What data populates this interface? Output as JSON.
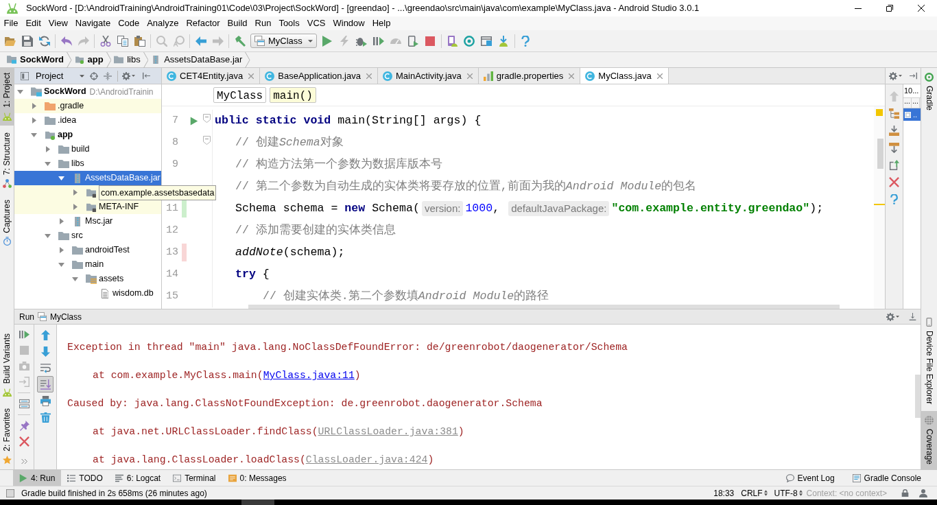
{
  "window": {
    "title": "SockWord - [D:\\AndroidTraining\\AndroidTraining01\\Code\\03\\Project\\SockWord] - [greendao] - ...\\greendao\\src\\main\\java\\com\\example\\MyClass.java - Android Studio 3.0.1"
  },
  "menu": [
    "File",
    "Edit",
    "View",
    "Navigate",
    "Code",
    "Analyze",
    "Refactor",
    "Build",
    "Run",
    "Tools",
    "VCS",
    "Window",
    "Help"
  ],
  "toolbar": [
    [
      {
        "kind": "open",
        "disabled": false
      },
      {
        "kind": "save",
        "disabled": false
      },
      {
        "kind": "sync",
        "disabled": false
      }
    ],
    [
      {
        "kind": "undo",
        "disabled": false
      },
      {
        "kind": "redo",
        "disabled": true
      }
    ],
    [
      {
        "kind": "cut",
        "disabled": false
      },
      {
        "kind": "copy",
        "disabled": false
      },
      {
        "kind": "paste",
        "disabled": false
      }
    ],
    [
      {
        "kind": "find",
        "disabled": true
      },
      {
        "kind": "replace",
        "disabled": true
      }
    ],
    [
      {
        "kind": "back",
        "disabled": false
      },
      {
        "kind": "forward",
        "disabled": true
      }
    ],
    [
      {
        "kind": "make",
        "disabled": false
      },
      {
        "kind": "run_config",
        "label": "MyClass"
      },
      {
        "kind": "run",
        "disabled": false
      },
      {
        "kind": "apply_changes",
        "disabled": true
      },
      {
        "kind": "debug",
        "disabled": false
      },
      {
        "kind": "profile",
        "disabled": false
      },
      {
        "kind": "attach",
        "disabled": true
      },
      {
        "kind": "attach_debugger",
        "disabled": false
      },
      {
        "kind": "stop",
        "disabled": false
      }
    ],
    [
      {
        "kind": "avd",
        "disabled": false
      },
      {
        "kind": "sync_gradle",
        "disabled": false
      },
      {
        "kind": "structure",
        "disabled": false
      },
      {
        "kind": "sdk",
        "disabled": false
      }
    ],
    [
      {
        "kind": "help",
        "disabled": false
      }
    ]
  ],
  "navigation_bar": [
    {
      "label": "SockWord",
      "kind": "project"
    },
    {
      "label": "app",
      "kind": "module"
    },
    {
      "label": "libs",
      "kind": "folder"
    },
    {
      "label": "AssetsDataBase.jar",
      "kind": "jar"
    }
  ],
  "left_tool_strip": {
    "top": [
      {
        "label": "1: Project",
        "kind": "android",
        "selected": true
      },
      {
        "label": "7: Structure",
        "kind": "structure",
        "selected": false
      },
      {
        "label": "Captures",
        "kind": "captures",
        "selected": false
      }
    ],
    "bottom": [
      {
        "label": "Build Variants",
        "kind": "android",
        "selected": false
      },
      {
        "label": "2: Favorites",
        "kind": "star",
        "selected": false
      }
    ]
  },
  "project_panel": {
    "title": "Project",
    "tree": [
      {
        "label": "SockWord",
        "kind": "project",
        "location": "D:\\AndroidTrainin",
        "expanded": true,
        "selected": false,
        "highlighted": false,
        "hovered": false,
        "children": [
          {
            "label": ".gradle",
            "kind": "excluded_folder",
            "expanded": false,
            "selected": false,
            "highlighted": true,
            "hovered": false
          },
          {
            "label": ".idea",
            "kind": "folder",
            "expanded": false,
            "selected": false,
            "highlighted": false,
            "hovered": false
          },
          {
            "label": "app",
            "kind": "module",
            "expanded": true,
            "selected": false,
            "highlighted": false,
            "hovered": false,
            "children": [
              {
                "label": "build",
                "kind": "folder",
                "expanded": false,
                "selected": false,
                "highlighted": false,
                "hovered": false
              },
              {
                "label": "libs",
                "kind": "folder",
                "expanded": true,
                "selected": false,
                "highlighted": false,
                "hovered": false,
                "children": [
                  {
                    "label": "AssetsDataBase.jar",
                    "kind": "jar",
                    "expanded": true,
                    "selected": true,
                    "highlighted": false,
                    "hovered": false,
                    "children": [
                      {
                        "label": "com.example.assetsbasedata",
                        "kind": "jar_package",
                        "expanded": false,
                        "selected": false,
                        "highlighted": true,
                        "hovered": true
                      },
                      {
                        "label": "META-INF",
                        "kind": "jar_package",
                        "expanded": false,
                        "selected": false,
                        "highlighted": true,
                        "hovered": false
                      }
                    ]
                  },
                  {
                    "label": "Msc.jar",
                    "kind": "jar",
                    "expanded": false,
                    "selected": false,
                    "highlighted": false,
                    "hovered": false
                  }
                ]
              },
              {
                "label": "src",
                "kind": "folder",
                "expanded": true,
                "selected": false,
                "highlighted": false,
                "hovered": false,
                "children": [
                  {
                    "label": "androidTest",
                    "kind": "folder",
                    "expanded": false,
                    "selected": false,
                    "highlighted": false,
                    "hovered": false
                  },
                  {
                    "label": "main",
                    "kind": "folder",
                    "expanded": true,
                    "selected": false,
                    "highlighted": false,
                    "hovered": false,
                    "children": [
                      {
                        "label": "assets",
                        "kind": "assets_folder",
                        "expanded": true,
                        "selected": false,
                        "highlighted": false,
                        "hovered": false,
                        "children": [
                          {
                            "label": "wisdom.db",
                            "kind": "file",
                            "selected": false,
                            "highlighted": false,
                            "hovered": false
                          }
                        ]
                      }
                    ]
                  }
                ]
              }
            ]
          }
        ]
      }
    ]
  },
  "editor": {
    "tabs": [
      {
        "label": "CET4Entity.java",
        "kind": "java",
        "selected": false
      },
      {
        "label": "BaseApplication.java",
        "kind": "java",
        "selected": false
      },
      {
        "label": "MainActivity.java",
        "kind": "java",
        "selected": false
      },
      {
        "label": "gradle.properties",
        "kind": "properties",
        "selected": false
      },
      {
        "label": "MyClass.java",
        "kind": "java",
        "selected": true
      }
    ],
    "breadcrumbs": [
      {
        "label": "MyClass",
        "selected": false
      },
      {
        "label": "main()",
        "selected": true
      }
    ],
    "lines": [
      {
        "number": "7",
        "run_marker": true,
        "fold": true,
        "segments": [
          {
            "kind": "keyword",
            "text": "ublic static void"
          },
          {
            "kind": "plain",
            "text": " main(String[] args) {"
          }
        ],
        "children": [
          {
            "number": "8",
            "run_marker": false,
            "fold": true,
            "segments": [
              {
                "kind": "comment",
                "text": "// 创建"
              },
              {
                "kind": "comment_italic",
                "text": "Schema"
              },
              {
                "kind": "comment",
                "text": "对象"
              }
            ]
          },
          {
            "number": "9",
            "run_marker": false,
            "fold": false,
            "segments": [
              {
                "kind": "comment",
                "text": "// 构造方法第一个参数为数据库版本号"
              }
            ]
          },
          {
            "run_marker": false,
            "fold": false,
            "segments": [
              {
                "kind": "comment",
                "text": "// 第二个参数为自动生成的实体类将要存放的位置,前面为我的"
              },
              {
                "kind": "comment_italic",
                "text": "Android Module"
              },
              {
                "kind": "comment",
                "text": "的包名"
              }
            ]
          },
          {
            "number": "11",
            "run_marker": false,
            "fold": false,
            "covered": true,
            "segments": [
              {
                "kind": "plain",
                "text": "Schema schema = "
              },
              {
                "kind": "keyword",
                "text": "new"
              },
              {
                "kind": "plain",
                "text": " Schema("
              },
              {
                "kind": "hint",
                "text": "version:"
              },
              {
                "kind": "number",
                "text": "1000"
              },
              {
                "kind": "plain",
                "text": ", "
              },
              {
                "kind": "hint",
                "text": "defaultJavaPackage:"
              },
              {
                "kind": "string",
                "text": "\"com.example.entity.greendao\""
              },
              {
                "kind": "plain",
                "text": ");"
              }
            ]
          },
          {
            "number": "12",
            "run_marker": false,
            "fold": false,
            "segments": [
              {
                "kind": "comment",
                "text": "// 添加需要创建的实体类信息"
              }
            ]
          },
          {
            "number": "13",
            "run_marker": false,
            "fold": false,
            "covered": false,
            "segments": [
              {
                "kind": "static_call",
                "text": "addNote"
              },
              {
                "kind": "plain",
                "text": "(schema);"
              }
            ]
          },
          {
            "number": "14",
            "run_marker": false,
            "fold": false,
            "segments": [
              {
                "kind": "keyword",
                "text": "try"
              },
              {
                "kind": "plain",
                "text": " {"
              }
            ],
            "children": [
              {
                "number": "15",
                "run_marker": false,
                "fold": false,
                "segments": [
                  {
                    "kind": "comment",
                    "text": "// 创建实体类.第二个参数填"
                  },
                  {
                    "kind": "comment_italic",
                    "text": "Android Module"
                  },
                  {
                    "kind": "comment",
                    "text": "的路径"
                  }
                ]
              }
            ]
          }
        ]
      }
    ]
  },
  "side_panel": {
    "tools": [
      {
        "kind": "up",
        "disabled": true
      },
      {
        "kind": "flatten",
        "disabled": false
      },
      {
        "kind": "generate",
        "disabled": false
      },
      {
        "kind": "expand",
        "disabled": false
      },
      {
        "kind": "export",
        "disabled": false
      },
      {
        "kind": "close",
        "disabled": false
      },
      {
        "kind": "help",
        "disabled": false
      }
    ],
    "header": "10...",
    "columns": [
      "...",
      "..."
    ],
    "rows": [
      {
        "label": "..",
        "selected": true
      }
    ]
  },
  "right_tool_strip": {
    "top": [
      {
        "label": "Gradle",
        "kind": "gradle",
        "selected": false
      }
    ],
    "bottom": [
      {
        "label": "Device File Explorer",
        "kind": "device",
        "selected": false
      },
      {
        "label": "Coverage",
        "kind": "coverage",
        "selected": true
      }
    ]
  },
  "run_panel": {
    "title": "Run",
    "configuration": "MyClass",
    "actions": [
      [
        {
          "kind": "rerun",
          "disabled": false
        },
        {
          "kind": "stop",
          "disabled": true
        },
        {
          "kind": "dump_threads",
          "disabled": true
        },
        {
          "kind": "exit",
          "disabled": true
        }
      ],
      [
        {
          "kind": "layout",
          "disabled": false
        }
      ],
      [
        {
          "kind": "pin",
          "disabled": false
        },
        {
          "kind": "close",
          "disabled": false
        }
      ],
      [
        {
          "kind": "more",
          "disabled": false
        }
      ]
    ],
    "console_tools": [
      {
        "kind": "up",
        "on": false
      },
      {
        "kind": "down",
        "on": false
      },
      {
        "kind": "soft_wrap",
        "on": false
      },
      {
        "kind": "scroll_to_end",
        "on": true
      },
      {
        "kind": "print",
        "on": false
      },
      {
        "kind": "clear",
        "on": false
      }
    ],
    "console": [
      {
        "segments": [
          {
            "kind": "text",
            "text": "Exception in thread \"main\" java.lang.NoClassDefFoundError: de/greenrobot/daogenerator/Schema"
          }
        ],
        "children": [
          {
            "segments": [
              {
                "kind": "text",
                "text": "at com.example.MyClass.main("
              },
              {
                "kind": "link",
                "text": "MyClass.java:11"
              },
              {
                "kind": "text",
                "text": ")"
              }
            ]
          }
        ]
      },
      {
        "segments": [
          {
            "kind": "text",
            "text": "Caused by: java.lang.ClassNotFoundException: de.greenrobot.daogenerator.Schema"
          }
        ],
        "children": [
          {
            "segments": [
              {
                "kind": "text",
                "text": "at java.net.URLClassLoader.findClass("
              },
              {
                "kind": "library_link",
                "text": "URLClassLoader.java:381"
              },
              {
                "kind": "text",
                "text": ")"
              }
            ]
          },
          {
            "segments": [
              {
                "kind": "text",
                "text": "at java.lang.ClassLoader.loadClass("
              },
              {
                "kind": "library_link",
                "text": "ClassLoader.java:424"
              },
              {
                "kind": "text",
                "text": ")"
              }
            ]
          }
        ]
      }
    ]
  },
  "bottom_tabs": {
    "left": [
      {
        "label": "4: Run",
        "kind": "run",
        "selected": true
      },
      {
        "label": "TODO",
        "kind": "todo",
        "selected": false
      },
      {
        "label": "6: Logcat",
        "kind": "logcat",
        "selected": false
      },
      {
        "label": "Terminal",
        "kind": "terminal",
        "selected": false
      },
      {
        "label": "0: Messages",
        "kind": "messages",
        "selected": false
      }
    ],
    "right": [
      {
        "label": "Event Log",
        "kind": "event_log",
        "selected": false
      },
      {
        "label": "Gradle Console",
        "kind": "gradle_console",
        "selected": false
      }
    ]
  },
  "status_bar": {
    "message": "Gradle build finished in 2s 658ms (26 minutes ago)",
    "caret_position": "18:33",
    "line_separator": "CRLF",
    "encoding": "UTF-8",
    "context": "Context: <no context>"
  }
}
